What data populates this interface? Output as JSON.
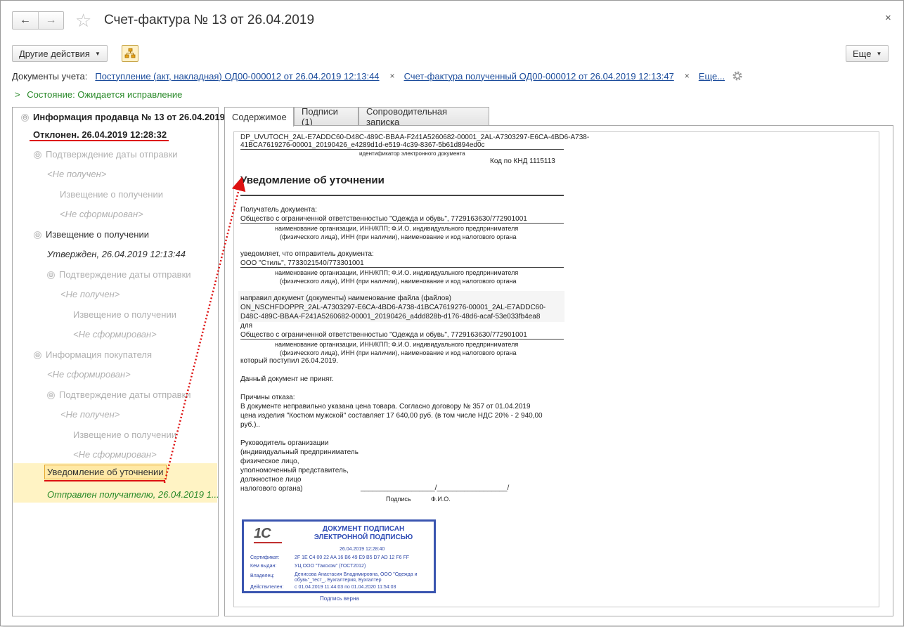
{
  "window": {
    "title": "Счет-фактура № 13 от 26.04.2019",
    "back_glyph": "←",
    "forward_glyph": "→",
    "star_glyph": "☆",
    "close_glyph": "×"
  },
  "toolbar": {
    "other_actions": "Другие действия",
    "more": "Еще"
  },
  "docs": {
    "label": "Документы учета:",
    "links": [
      "Поступление (акт, накладная) ОД00-000012 от 26.04.2019 12:13:44",
      "Счет-фактура полученный ОД00-000012 от 26.04.2019 12:13:47"
    ],
    "more_link": "Еще...",
    "remove_glyph": "×"
  },
  "state": {
    "chevron": ">",
    "text": "Состояние: Ожидается исправление"
  },
  "tree": {
    "items": [
      {
        "text": "Информация продавца № 13 от 26.04.2019",
        "minus": "⊖"
      },
      {
        "text": "Отклонен. 26.04.2019 12:28:32"
      },
      {
        "text": "Подтверждение даты отправки",
        "minus": "⊖"
      },
      {
        "text": "<Не получен>"
      },
      {
        "text": "Извещение о получении"
      },
      {
        "text": "<Не сформирован>"
      },
      {
        "text": "Извещение о получении",
        "minus": "⊖"
      },
      {
        "text": "Утвержден, 26.04.2019 12:13:44"
      },
      {
        "text": "Подтверждение даты отправки",
        "minus": "⊖"
      },
      {
        "text": "<Не получен>"
      },
      {
        "text": "Извещение о получении"
      },
      {
        "text": "<Не сформирован>"
      },
      {
        "text": "Информация покупателя",
        "minus": "⊖"
      },
      {
        "text": "<Не сформирован>"
      },
      {
        "text": "Подтверждение даты отправки",
        "minus": "⊖"
      },
      {
        "text": "<Не получен>"
      },
      {
        "text": "Извещение о получении"
      },
      {
        "text": "<Не сформирован>"
      },
      {
        "text": "Уведомление об уточнении"
      },
      {
        "text": "Отправлен получателю, 26.04.2019 1..."
      }
    ]
  },
  "tabs": [
    "Содержимое",
    "Подписи (1)",
    "Сопроводительная записка"
  ],
  "document": {
    "id_line1": "DP_UVUTOCH_2AL-E7ADDC60-D48C-489C-BBAA-F241A5260682-00001_2AL-A7303297-E6CA-4BD6-A738-",
    "id_line2": "41BCA7619276-00001_20190426_e4289d1d-e519-4c39-8367-5b61d894ed0c",
    "id_caption": "идентификатор электронного документа",
    "knd": "Код по КНД 1115113",
    "heading": "Уведомление об уточнении",
    "recipient_label": "Получатель документа:",
    "recipient": "Общество с ограниченной ответственностью \"Одежда и обувь\", 7729163630/772901001",
    "caption1": "наименование организации, ИНН/КПП; Ф.И.О. индивидуального предпринимателя",
    "caption2": "(физического лица), ИНН (при наличии), наименование и код налогового органа",
    "notifies": "уведомляет, что отправитель документа:",
    "sender": "ООО \"Стиль\", 7733021540/773301001",
    "sent_label": "направил документ (документы) наименование файла (файлов)",
    "file_line1": "ON_NSCHFDOPPR_2AL-A7303297-E6CA-4BD6-A738-41BCA7619276-00001_2AL-E7ADDC60-",
    "file_line2": "D48C-489C-BBAA-F241A5260682-00001_20190426_a4dd828b-d176-48d6-acaf-53e033fb4ea8",
    "for_label": "для",
    "for_org": "Общество с ограниченной ответственностью \"Одежда и обувь\", 7729163630/772901001",
    "received": "который поступил 26.04.2019.",
    "not_accepted": "Данный документ не принят.",
    "reasons_label": "Причины отказа:",
    "reason1": "В документе неправильно указана цена товара. Согласно договору № 357 от 01.04.2019",
    "reason2": "цена изделия \"Костюм мужской\" составляет 17 640,00 руб. (в том числе НДС 20% - 2 940,00",
    "reason3": "руб.)..",
    "head1": "Руководитель  организации",
    "head2": "(индивидуальный предприниматель",
    "head3": "физическое лицо,",
    "head4": "уполномоченный представитель,",
    "head5": "должностное лицо",
    "head6": "налогового органа)",
    "sign_blank": "___________________/__________________/",
    "sign_caption": "Подпись",
    "fio_caption": "Ф.И.О."
  },
  "stamp": {
    "logo": "1С",
    "title1": "ДОКУМЕНТ ПОДПИСАН",
    "title2": "ЭЛЕКТРОННОЙ ПОДПИСЬЮ",
    "date": "26.04.2019 12:28:40",
    "cert_label": "Сертификат:",
    "cert": "2F 1E C4 00 22 AA 16 B6 49 E9 B5 D7 AD 12 F6 FF",
    "issuer_label": "Кем выдан:",
    "issuer": "УЦ ООО \"Такском\" (ГОСТ2012)",
    "owner_label": "Владелец:",
    "owner1": "Денисова Анастасия Владимировна, ООО \"Одежда и",
    "owner2": "обувь\"_тест_, Бухгалтерия, Бухгалтер",
    "valid_label": "Действителен:",
    "valid": "с 01.04.2019 11:44:03 по 01.04.2020 11:54:03",
    "verified": "Подпись верна"
  },
  "colors": {
    "link": "#1a4b9b",
    "state": "#2a8a2a",
    "annotation": "#dd1111",
    "highlight": "#fff3c4",
    "stamp": "#3a55b0"
  }
}
